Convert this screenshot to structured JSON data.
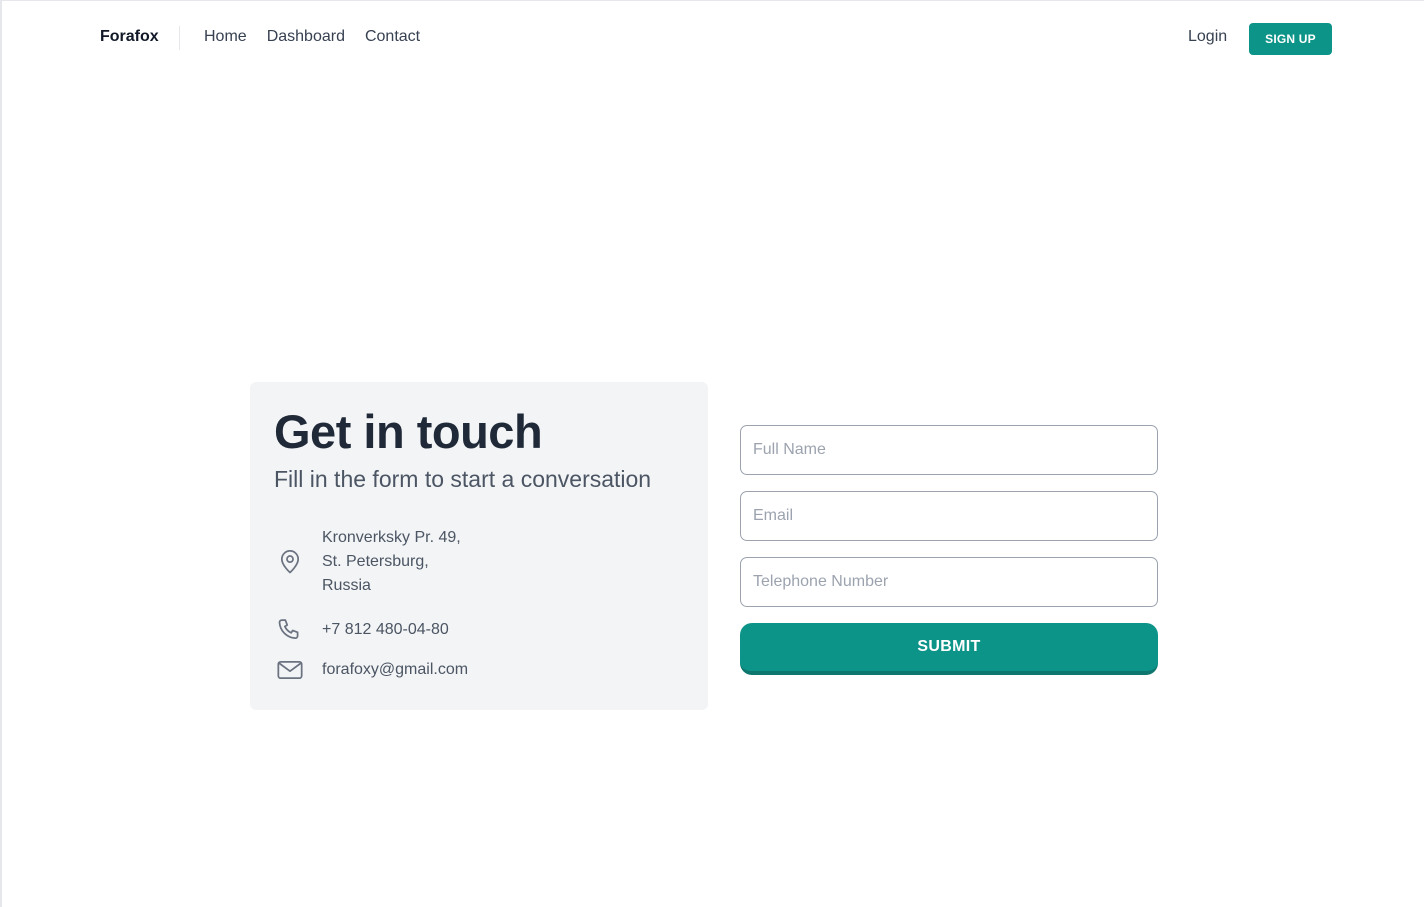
{
  "nav": {
    "brand": "Forafox",
    "links": [
      "Home",
      "Dashboard",
      "Contact"
    ],
    "login": "Login",
    "signup": "SIGN UP"
  },
  "card": {
    "title": "Get in touch",
    "subtitle": "Fill in the form to start a conversation",
    "address_lines": [
      "Kronverksky Pr. 49,",
      "St. Petersburg,",
      "Russia"
    ],
    "phone": "+7 812 480-04-80",
    "email": "forafoxy@gmail.com",
    "icons": [
      "location-pin-icon",
      "phone-icon",
      "mail-icon"
    ]
  },
  "form": {
    "full_name_placeholder": "Full Name",
    "email_placeholder": "Email",
    "telephone_placeholder": "Telephone Number",
    "submit_label": "SUBMIT"
  },
  "colors": {
    "accent": "#0d9488",
    "card_bg": "#f3f4f6"
  }
}
